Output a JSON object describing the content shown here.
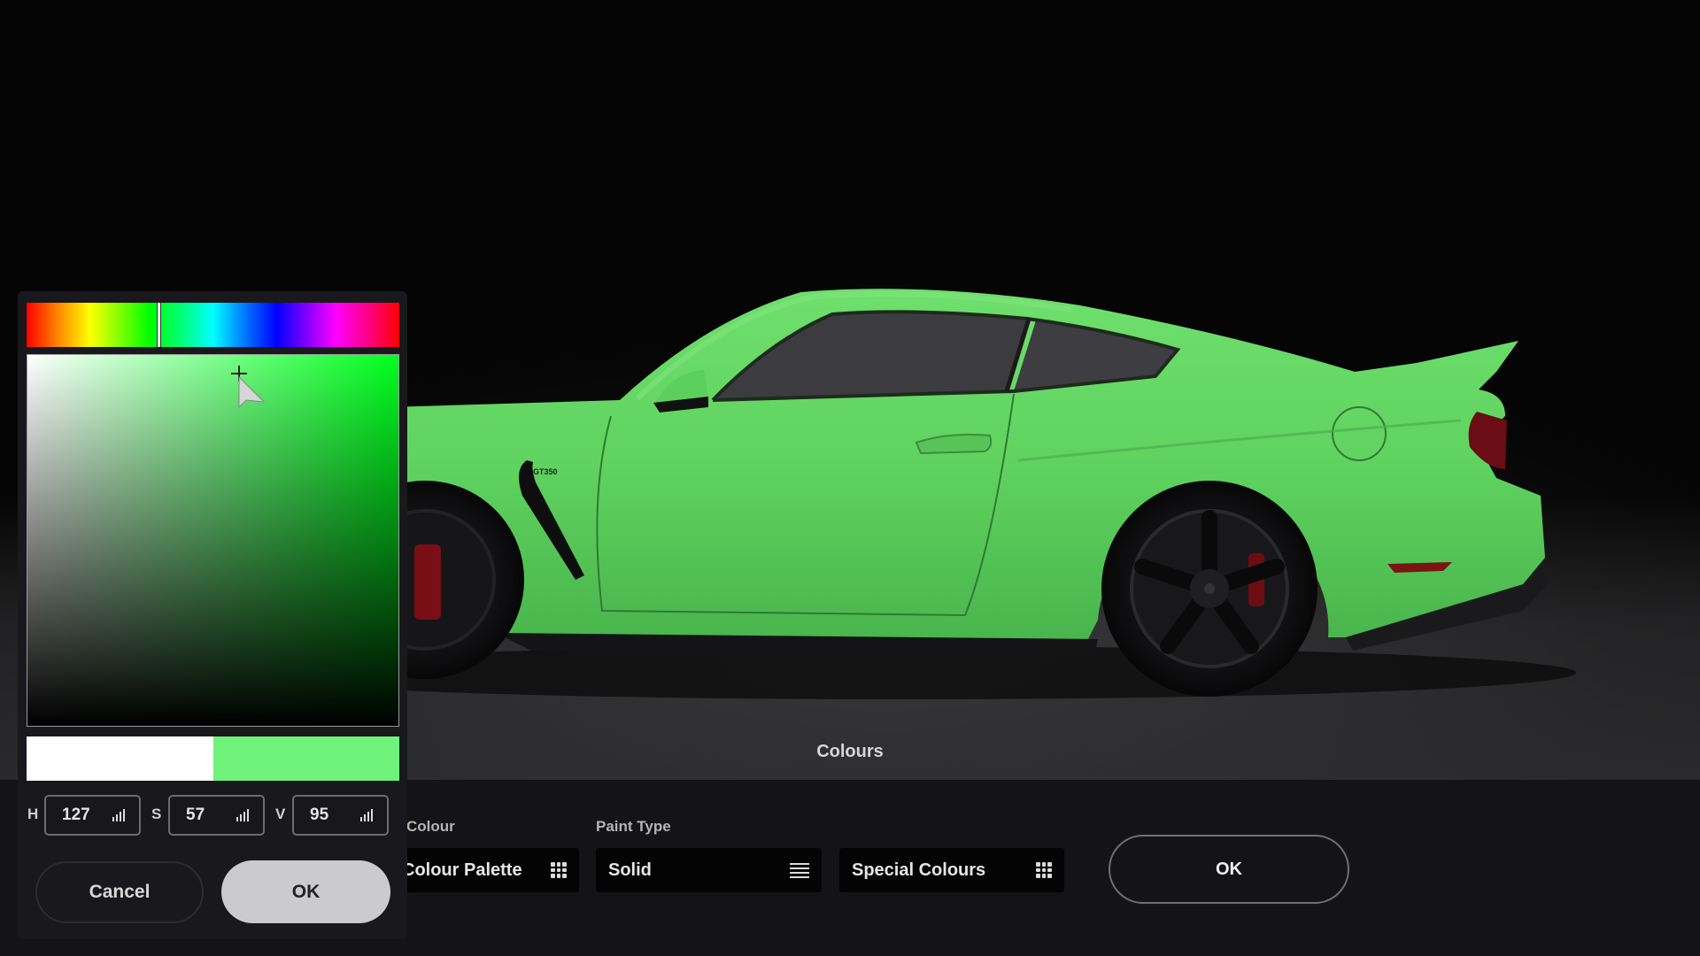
{
  "scene": {
    "title": "Colours",
    "car_colour": "#63d862",
    "badge_text": "GT350"
  },
  "picker": {
    "hue_deg": 127,
    "saturation_pct": 57,
    "value_pct": 95,
    "hue_field_label": "H",
    "saturation_field_label": "S",
    "value_field_label": "V",
    "hue_value": "127",
    "saturation_value": "57",
    "value_value": "95",
    "previous_colour": "#ffffff",
    "new_colour": "#6ef27a",
    "cancel_label": "Cancel",
    "ok_label": "OK"
  },
  "toolbar": {
    "colour_label": "Colour",
    "colour_value": "Colour Palette",
    "paint_type_label": "Paint Type",
    "paint_type_value": "Solid",
    "special_value": "Special Colours",
    "ok_label": "OK"
  }
}
